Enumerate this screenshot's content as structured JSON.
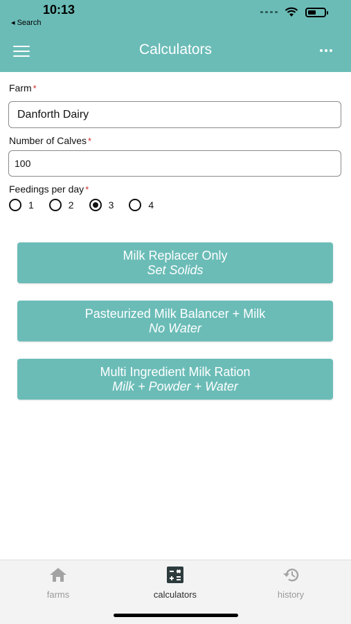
{
  "status_bar": {
    "time": "10:13",
    "back": "◂ Search"
  },
  "header": {
    "title": "Calculators"
  },
  "form": {
    "farm": {
      "label": "Farm",
      "required": "*",
      "value": "Danforth Dairy"
    },
    "calves": {
      "label": "Number of Calves",
      "required": "*",
      "value": "100"
    },
    "feedings": {
      "label": "Feedings per day",
      "required": "*",
      "options": [
        "1",
        "2",
        "3",
        "4"
      ],
      "selected": "3"
    }
  },
  "buttons": [
    {
      "line1": "Milk Replacer Only",
      "line2": "Set Solids"
    },
    {
      "line1": "Pasteurized Milk Balancer + Milk",
      "line2": "No Water"
    },
    {
      "line1": "Multi Ingredient Milk Ration",
      "line2": "Milk + Powder + Water"
    }
  ],
  "tabs": [
    {
      "label": "farms",
      "icon": "home-icon"
    },
    {
      "label": "calculators",
      "icon": "calculator-icon"
    },
    {
      "label": "history",
      "icon": "history-icon"
    }
  ],
  "colors": {
    "accent": "#6bbcb7",
    "required": "#d62b2b",
    "tab_active": "#2d2d2d",
    "tab_inactive": "#9a9a9a"
  }
}
